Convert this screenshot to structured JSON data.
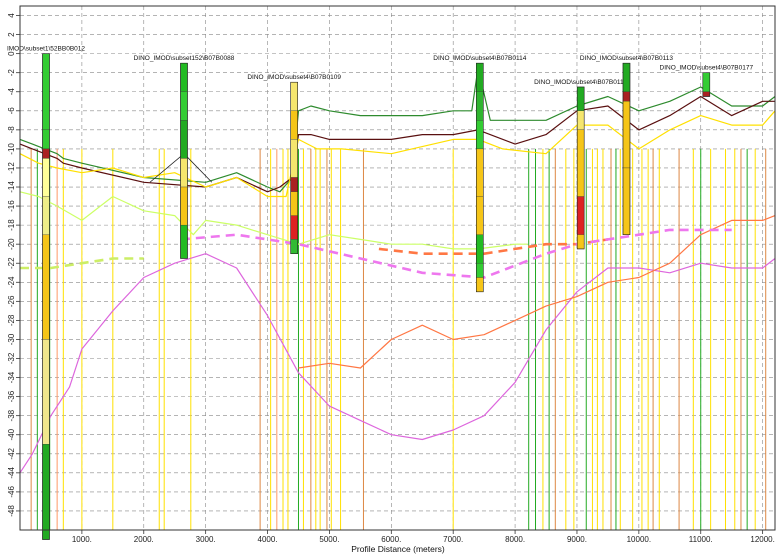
{
  "chart_data": {
    "type": "line",
    "title": "",
    "xlabel": "Profile Distance (meters)",
    "ylabel": "",
    "xlim": [
      0,
      12200
    ],
    "ylim": [
      -50,
      5
    ],
    "x_ticks": [
      "1000.",
      "2000.",
      "3000.",
      "4000.",
      "5000.",
      "6000.",
      "7000.",
      "8000.",
      "9000.",
      "10000.",
      "11000.",
      "12000."
    ],
    "x_tick_values": [
      1000,
      2000,
      3000,
      4000,
      5000,
      6000,
      7000,
      8000,
      9000,
      10000,
      11000,
      12000
    ],
    "y_ticks": [
      "4",
      "2",
      "0",
      "-2",
      "-4",
      "-6",
      "-8",
      "-10",
      "-12",
      "-14",
      "-16",
      "-18",
      "-20",
      "-22",
      "-24",
      "-26",
      "-28",
      "-30",
      "-32",
      "-34",
      "-36",
      "-38",
      "-40",
      "-42",
      "-44",
      "-46",
      "-48"
    ],
    "y_tick_values": [
      4,
      2,
      0,
      -2,
      -4,
      -6,
      -8,
      -10,
      -12,
      -14,
      -16,
      -18,
      -20,
      -22,
      -24,
      -26,
      -28,
      -30,
      -32,
      -34,
      -36,
      -38,
      -40,
      -42,
      -44,
      -46,
      -48
    ],
    "grid": true,
    "series": [
      {
        "color": "#2e8b2e",
        "x": [
          0,
          200,
          400,
          600,
          700,
          1000,
          2000,
          3000,
          3500,
          4000,
          4200,
          4400,
          4500,
          4700,
          5000,
          5500,
          6000,
          6500,
          7000,
          7300,
          7400,
          7600,
          8000,
          8500,
          9000,
          9500,
          10000,
          10500,
          11000,
          11500,
          12000,
          12200
        ],
        "y": [
          -9,
          -9.5,
          -10,
          -10.5,
          -11,
          -11.5,
          -13,
          -13.5,
          -12.5,
          -14,
          -14.5,
          -13,
          -6,
          -5.5,
          -6,
          -6.5,
          -6.5,
          -6.5,
          -6,
          -6,
          -1.5,
          -7,
          -7,
          -7,
          -5.5,
          -4.5,
          -6,
          -5,
          -3.5,
          -5.5,
          -5.5,
          -4.5
        ]
      },
      {
        "color": "#5a1010",
        "x": [
          0,
          200,
          400,
          600,
          700,
          1000,
          2000,
          3000,
          3500,
          4000,
          4200,
          4400,
          4500,
          4700,
          5000,
          5500,
          6000,
          6500,
          7000,
          7400,
          8000,
          8500,
          9000,
          9500,
          10000,
          10500,
          11000,
          11500,
          12000,
          12200
        ],
        "y": [
          -9.5,
          -10,
          -10.5,
          -11,
          -11.5,
          -12,
          -13.5,
          -14,
          -13,
          -14.5,
          -14,
          -13,
          -8.5,
          -8.5,
          -9,
          -9,
          -9,
          -8.5,
          -8.5,
          -8,
          -9.5,
          -8.5,
          -6,
          -5.5,
          -8,
          -6.5,
          -4.5,
          -6.5,
          -5,
          -5
        ]
      },
      {
        "color": "#ffe000",
        "x": [
          0,
          300,
          600,
          1000,
          1500,
          2000,
          2500,
          3000,
          3500,
          4000,
          4300,
          4500,
          4800,
          5200,
          6000,
          7000,
          7400,
          7800,
          8500,
          9000,
          9500,
          10000,
          10500,
          11000,
          11500,
          12000,
          12200
        ],
        "y": [
          -10.5,
          -11.5,
          -12,
          -12.5,
          -12,
          -13,
          -12.5,
          -14,
          -13,
          -15,
          -15,
          -9,
          -10,
          -10,
          -10.5,
          -9,
          -9,
          -10,
          -10.5,
          -7.5,
          -7.5,
          -10,
          -8,
          -6.5,
          -7.5,
          -7.5,
          -6
        ]
      },
      {
        "color": "#ccff66",
        "x": [
          0,
          300,
          600,
          1000,
          1500,
          2000,
          2500,
          2800,
          3000,
          3500,
          4000,
          4500,
          5000,
          5500,
          6000,
          6500,
          7000,
          7400,
          8000,
          8200
        ],
        "y": [
          -14.5,
          -15,
          -16,
          -17.5,
          -15,
          -16.5,
          -17,
          -19,
          -17.5,
          -18,
          -19,
          -20,
          -19,
          -19.5,
          -20,
          -20,
          -20.5,
          -20.5,
          -20,
          -20
        ]
      },
      {
        "color": "#dd66dd",
        "x": [
          0,
          200,
          500,
          800,
          1000,
          1500,
          2000,
          2500,
          3000,
          3500,
          4000,
          4500,
          5000,
          5500,
          6000,
          6500,
          7000,
          7500,
          8000,
          8500,
          9000,
          9500,
          10000,
          10500,
          11000,
          11500,
          12000,
          12200
        ],
        "y": [
          -44,
          -42,
          -38,
          -35,
          -31,
          -27,
          -23.5,
          -22,
          -21,
          -22.5,
          -27.5,
          -33.5,
          -37,
          -38.5,
          -40,
          -40.5,
          -39.5,
          -38,
          -34.5,
          -29,
          -25,
          -22.5,
          -22.5,
          -23,
          -22,
          -22.5,
          -22.5,
          -21.5
        ]
      },
      {
        "color": "#ff7744",
        "x": [
          4500,
          5000,
          5500,
          6000,
          6500,
          7000,
          7500,
          8000,
          8500,
          9000,
          9500,
          10000,
          10500,
          11000,
          11500,
          12000,
          12200
        ],
        "y": [
          -33,
          -32.5,
          -33,
          -30,
          -28.5,
          -30,
          -29.5,
          -28,
          -26.5,
          -25.5,
          -24,
          -23.5,
          -22,
          -19,
          -17.5,
          -17.5,
          -17
        ]
      },
      {
        "color": "#ff7744",
        "dashed": true,
        "x": [
          5800,
          6500,
          7500,
          8000,
          8500,
          9000,
          9500
        ],
        "y": [
          -20.5,
          -21,
          -21,
          -20.5,
          -20,
          -20,
          -19.5
        ]
      },
      {
        "color": "#ee77ee",
        "dashed": true,
        "x": [
          2600,
          3500,
          4500,
          5500,
          6500,
          7500,
          8500,
          9000,
          9500,
          10000,
          10500,
          11000,
          11500
        ],
        "y": [
          -19.5,
          -19,
          -20,
          -21.5,
          -23,
          -23.5,
          -21,
          -20,
          -19.5,
          -19,
          -18.5,
          -18.5,
          -18.5
        ]
      },
      {
        "color": "#ccee66",
        "dashed": true,
        "x": [
          0,
          500,
          1000,
          1500,
          2000
        ],
        "y": [
          -22.5,
          -22.5,
          -22,
          -21.5,
          -21.5
        ]
      }
    ],
    "boreholes": [
      {
        "label": "IMOD\\subset1\\52BB0B012",
        "x": 420,
        "top": 0,
        "bottom": -51,
        "segments": [
          [
            0,
            -8,
            "#33cc33"
          ],
          [
            -8,
            -10,
            "#33cc33"
          ],
          [
            -10,
            -11,
            "#aa2222"
          ],
          [
            -11,
            -15,
            "#ffff99"
          ],
          [
            -15,
            -19,
            "#eeee88"
          ],
          [
            -19,
            -30,
            "#f5c518"
          ],
          [
            -30,
            -41,
            "#f0e68c"
          ],
          [
            -41,
            -51,
            "#22aa22"
          ]
        ]
      },
      {
        "label": "DINO_IMOD\\subset152\\B07B0088",
        "x": 2650,
        "top": -1,
        "bottom": -21.5,
        "segments": [
          [
            -1,
            -4,
            "#22bb22"
          ],
          [
            -4,
            -7,
            "#33cc33"
          ],
          [
            -7,
            -11,
            "#22aa22"
          ],
          [
            -11,
            -14,
            "#f5e66e"
          ],
          [
            -14,
            -18,
            "#f5c518"
          ],
          [
            -18,
            -21.5,
            "#22bb22"
          ]
        ]
      },
      {
        "label": "DINO_IMOD\\subset4\\B07B0109",
        "x": 4430,
        "top": -3,
        "bottom": -21,
        "segments": [
          [
            -3,
            -6,
            "#f5e66e"
          ],
          [
            -6,
            -9,
            "#f5c518"
          ],
          [
            -9,
            -13,
            "#f5e66e"
          ],
          [
            -13,
            -14.5,
            "#aa2222"
          ],
          [
            -14.5,
            -17,
            "#f5c518"
          ],
          [
            -17,
            -19.5,
            "#dd2222"
          ],
          [
            -19.5,
            -21,
            "#33bb33"
          ]
        ]
      },
      {
        "label": "DINO_IMOD\\subset4\\B07B0114",
        "x": 7430,
        "top": -1,
        "bottom": -25,
        "segments": [
          [
            -1,
            -4,
            "#22aa22"
          ],
          [
            -4,
            -7,
            "#2fb52f"
          ],
          [
            -7,
            -10,
            "#33cc33"
          ],
          [
            -10,
            -15,
            "#f5c518"
          ],
          [
            -15,
            -19,
            "#f5c518"
          ],
          [
            -19,
            -22,
            "#22bb22"
          ],
          [
            -22,
            -23.5,
            "#33cc33"
          ],
          [
            -23.5,
            -25,
            "#f5c518"
          ]
        ]
      },
      {
        "label": "DINO_IMOD\\subset4\\B07B0118",
        "x": 9060,
        "top": -3.5,
        "bottom": -20.5,
        "segments": [
          [
            -3.5,
            -6,
            "#22aa22"
          ],
          [
            -6,
            -8,
            "#f5e66e"
          ],
          [
            -8,
            -15,
            "#f5c518"
          ],
          [
            -15,
            -19,
            "#dd2222"
          ],
          [
            -19,
            -20.5,
            "#f5c518"
          ]
        ]
      },
      {
        "label": "DINO_IMOD\\subset4\\B07B0113",
        "x": 9800,
        "top": -1,
        "bottom": -19,
        "segments": [
          [
            -1,
            -4,
            "#22aa22"
          ],
          [
            -4,
            -5,
            "#aa2222"
          ],
          [
            -5,
            -12,
            "#f5c518"
          ],
          [
            -12,
            -19,
            "#f5c518"
          ]
        ]
      },
      {
        "label": "DINO_IMOD\\subset4\\B07B0177",
        "x": 11090,
        "top": -2,
        "bottom": -4.5,
        "segments": [
          [
            -2,
            -4,
            "#33cc33"
          ],
          [
            -4,
            -4.5,
            "#aa2222"
          ]
        ]
      }
    ],
    "drop_lines": [
      {
        "x": 180,
        "color": "#dd8844"
      },
      {
        "x": 280,
        "color": "#22aa22"
      },
      {
        "x": 480,
        "color": "#22aa22"
      },
      {
        "x": 600,
        "color": "#ff9966"
      },
      {
        "x": 700,
        "color": "#ffe000"
      },
      {
        "x": 1000,
        "color": "#ffe000"
      },
      {
        "x": 1500,
        "color": "#ffe000"
      },
      {
        "x": 2250,
        "color": "#ffe000"
      },
      {
        "x": 2330,
        "color": "#ffe000"
      },
      {
        "x": 2760,
        "color": "#ffe000"
      },
      {
        "x": 3880,
        "color": "#dd8844"
      },
      {
        "x": 4050,
        "color": "#ffe000"
      },
      {
        "x": 4150,
        "color": "#ff9966"
      },
      {
        "x": 4250,
        "color": "#ffe000"
      },
      {
        "x": 4330,
        "color": "#ffe000"
      },
      {
        "x": 4500,
        "color": "#22aa22"
      },
      {
        "x": 4580,
        "color": "#ffe000"
      },
      {
        "x": 4700,
        "color": "#dd8844"
      },
      {
        "x": 4780,
        "color": "#ffe000"
      },
      {
        "x": 4850,
        "color": "#ffe000"
      },
      {
        "x": 4960,
        "color": "#dd8844"
      },
      {
        "x": 5030,
        "color": "#ffe000"
      },
      {
        "x": 5180,
        "color": "#ffe000"
      },
      {
        "x": 5550,
        "color": "#dd8844"
      },
      {
        "x": 7000,
        "color": "#ffe000"
      },
      {
        "x": 8220,
        "color": "#22aa22"
      },
      {
        "x": 8330,
        "color": "#22aa22"
      },
      {
        "x": 8450,
        "color": "#ffe000"
      },
      {
        "x": 8550,
        "color": "#22aa22"
      },
      {
        "x": 8650,
        "color": "#dd8844"
      },
      {
        "x": 8820,
        "color": "#ffe000"
      },
      {
        "x": 8950,
        "color": "#ffe000"
      },
      {
        "x": 9150,
        "color": "#22aa22"
      },
      {
        "x": 9250,
        "color": "#ffe000"
      },
      {
        "x": 9330,
        "color": "#ffe000"
      },
      {
        "x": 9420,
        "color": "#ffe000"
      },
      {
        "x": 9550,
        "color": "#dd8844"
      },
      {
        "x": 9630,
        "color": "#22aa22"
      },
      {
        "x": 9700,
        "color": "#ffe000"
      },
      {
        "x": 9900,
        "color": "#ffe000"
      },
      {
        "x": 10050,
        "color": "#ffe000"
      },
      {
        "x": 10150,
        "color": "#ffe000"
      },
      {
        "x": 10230,
        "color": "#dd8844"
      },
      {
        "x": 10330,
        "color": "#ffe000"
      },
      {
        "x": 10650,
        "color": "#dd8844"
      },
      {
        "x": 10880,
        "color": "#ffe000"
      },
      {
        "x": 11000,
        "color": "#22aa22"
      },
      {
        "x": 11160,
        "color": "#ffe000"
      },
      {
        "x": 11400,
        "color": "#ffe000"
      },
      {
        "x": 11550,
        "color": "#ffe000"
      },
      {
        "x": 11650,
        "color": "#dd8844"
      },
      {
        "x": 11750,
        "color": "#22aa22"
      },
      {
        "x": 11880,
        "color": "#ffe000"
      },
      {
        "x": 12050,
        "color": "#dd8844"
      }
    ],
    "annotation_lines": [
      {
        "x1": 2100,
        "y1": -13.5,
        "x2": 2650,
        "y2": -10.5
      },
      {
        "x1": 2650,
        "y1": -10.5,
        "x2": 3100,
        "y2": -13.5
      }
    ],
    "colors": {
      "plot_background": "#ffffff",
      "grid": "#888888",
      "axis": "#333333"
    }
  }
}
